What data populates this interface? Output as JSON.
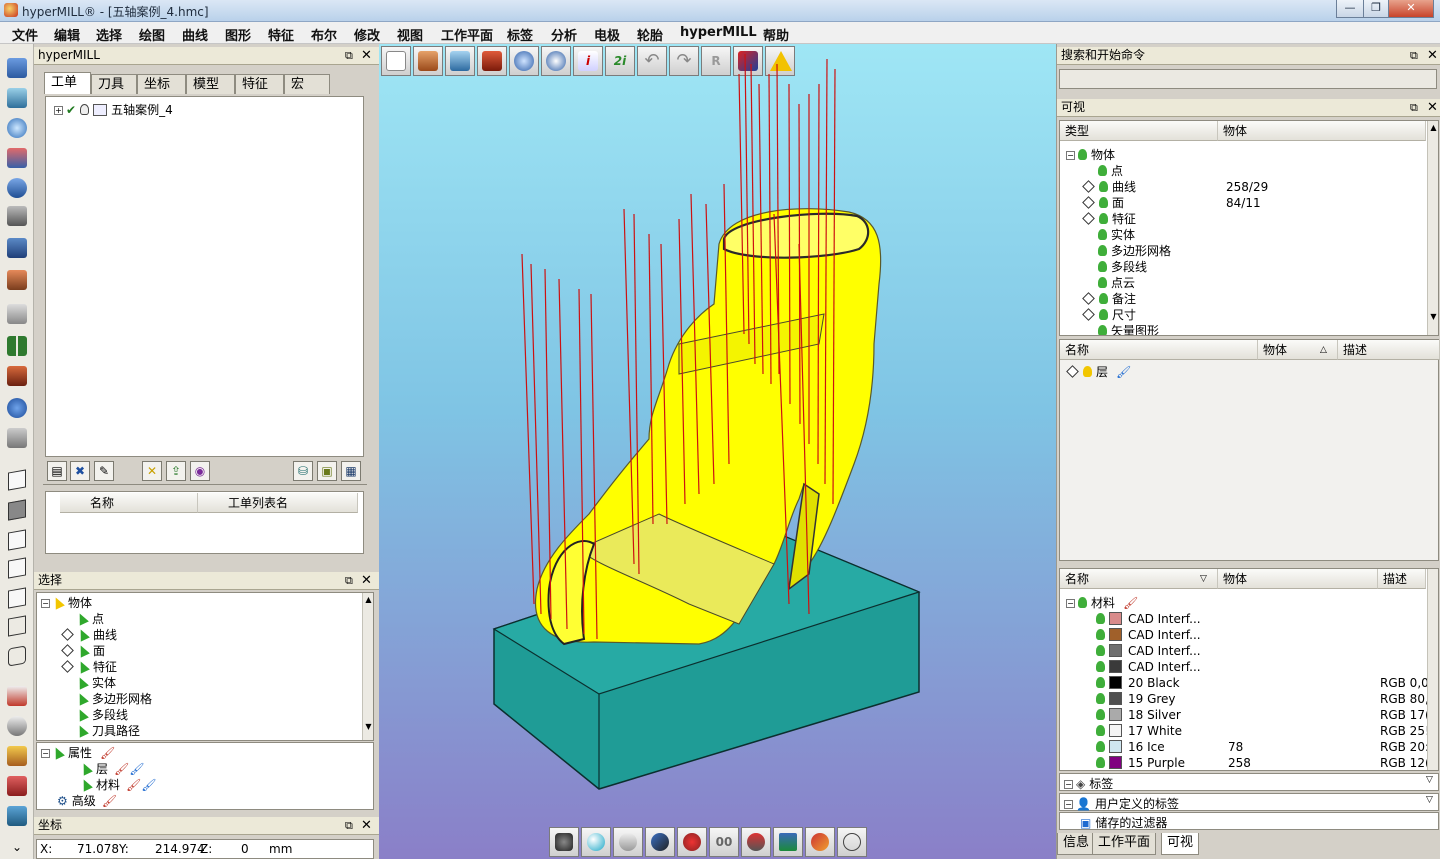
{
  "window": {
    "title": "hyperMILL® - [五轴案例_4.hmc]",
    "controls": [
      "—",
      "❐",
      "✕"
    ]
  },
  "menu": [
    "文件",
    "编辑",
    "选择",
    "绘图",
    "曲线",
    "图形",
    "特征",
    "布尔",
    "修改",
    "视图",
    "工作平面",
    "标签",
    "分析",
    "电极",
    "轮胎",
    "hyperMILL",
    "帮助"
  ],
  "hypermill_panel": {
    "title": "hyperMILL",
    "tabs": [
      "工单",
      "刀具",
      "坐标",
      "模型",
      "特征",
      "宏"
    ],
    "active_tab": "工单",
    "tree_item": "五轴案例_4",
    "list_columns": [
      "名称",
      "工单列表名"
    ]
  },
  "selection_panel": {
    "title": "选择",
    "root": "物体",
    "items": [
      {
        "label": "点",
        "expand": false
      },
      {
        "label": "曲线",
        "expand": true
      },
      {
        "label": "面",
        "expand": true
      },
      {
        "label": "特征",
        "expand": true
      },
      {
        "label": "实体",
        "expand": false
      },
      {
        "label": "多边形网格",
        "expand": false
      },
      {
        "label": "多段线",
        "expand": false
      },
      {
        "label": "刀具路径",
        "expand": false
      }
    ],
    "attr_root": "属性",
    "attr_items": [
      "层",
      "材料"
    ],
    "advanced": "高级"
  },
  "coord_panel": {
    "title": "坐标",
    "x_label": "X:",
    "x_value": "71.078",
    "y_label": "Y:",
    "y_value": "214.974",
    "z_label": "Z:",
    "z_value": "0",
    "unit": "mm"
  },
  "search_panel": {
    "title": "搜索和开始命令",
    "placeholder": ""
  },
  "visible_panel": {
    "title": "可视",
    "columns": [
      "类型",
      "物体"
    ],
    "root": "物体",
    "items": [
      {
        "label": "点",
        "count": "",
        "expand": false
      },
      {
        "label": "曲线",
        "count": "258/29",
        "expand": true
      },
      {
        "label": "面",
        "count": "84/11",
        "expand": true
      },
      {
        "label": "特征",
        "count": "",
        "expand": true
      },
      {
        "label": "实体",
        "count": "",
        "expand": false
      },
      {
        "label": "多边形网格",
        "count": "",
        "expand": false
      },
      {
        "label": "多段线",
        "count": "",
        "expand": false
      },
      {
        "label": "点云",
        "count": "",
        "expand": false
      },
      {
        "label": "备注",
        "count": "",
        "expand": true
      },
      {
        "label": "尺寸",
        "count": "",
        "expand": true
      },
      {
        "label": "矢量图形",
        "count": "",
        "expand": false
      }
    ]
  },
  "layer_panel": {
    "columns": [
      "名称",
      "物体",
      "描述"
    ],
    "item": "层"
  },
  "material_panel": {
    "columns": [
      "名称",
      "物体",
      "描述"
    ],
    "root": "材料",
    "items": [
      {
        "name": "CAD Interf...",
        "count": "",
        "desc": "",
        "color": "#d98b8b"
      },
      {
        "name": "CAD Interf...",
        "count": "",
        "desc": "",
        "color": "#a0602a"
      },
      {
        "name": "CAD Interf...",
        "count": "",
        "desc": "",
        "color": "#6f6f6f"
      },
      {
        "name": "CAD Interf...",
        "count": "",
        "desc": "",
        "color": "#3a3a3a"
      },
      {
        "name": "20 Black",
        "count": "",
        "desc": "RGB 0,0",
        "color": "#000000"
      },
      {
        "name": "19 Grey",
        "count": "",
        "desc": "RGB 80,",
        "color": "#505050"
      },
      {
        "name": "18 Silver",
        "count": "",
        "desc": "RGB 17(",
        "color": "#aaaaaa"
      },
      {
        "name": "17 White",
        "count": "",
        "desc": "RGB 25!",
        "color": "#f4f4f4"
      },
      {
        "name": "16 Ice",
        "count": "78",
        "desc": "RGB 20:",
        "color": "#cfe6f0"
      },
      {
        "name": "15 Purple",
        "count": "258",
        "desc": "RGB 12(",
        "color": "#800080"
      }
    ]
  },
  "collapsed_sections": [
    "标签",
    "用户定义的标签",
    "储存的过滤器"
  ],
  "bottom_tabs": [
    "信息",
    "工作平面",
    "可视"
  ],
  "active_bottom_tab": "可视",
  "colors": {
    "accent": "#3fae3a",
    "viewport_top": "#9fe6f5",
    "viewport_bottom": "#8a7fc8",
    "stock": "#1f9c96",
    "toolpath": "#ffff00",
    "tool_axis": "#cc1111"
  }
}
